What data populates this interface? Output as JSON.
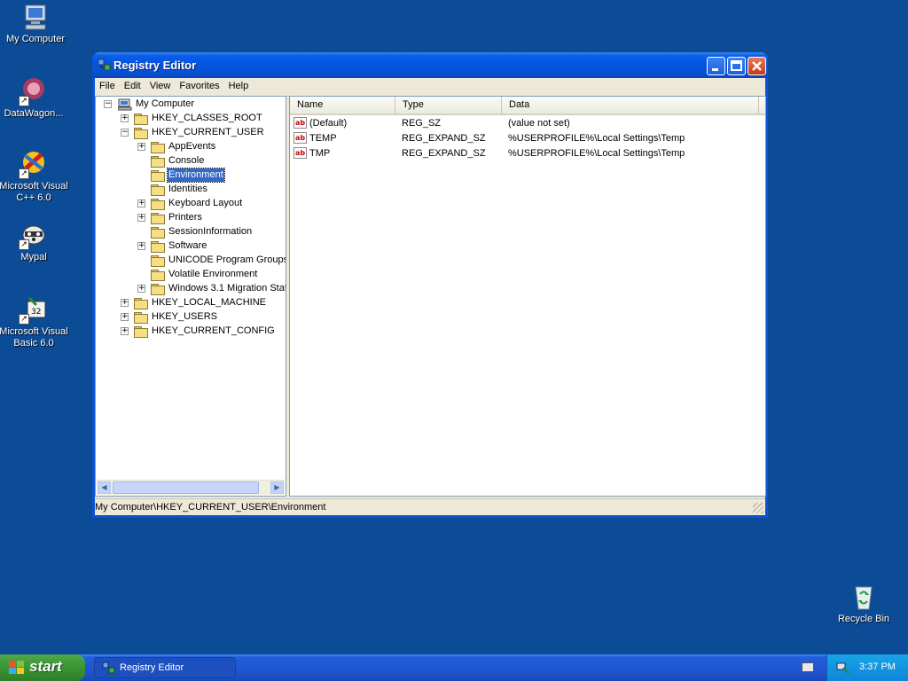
{
  "desktop": {
    "icons": [
      {
        "label": "My Computer"
      },
      {
        "label": "DataWagon..."
      },
      {
        "label": "Microsoft Visual\nC++ 6.0"
      },
      {
        "label": "Mypal"
      },
      {
        "label": "Microsoft Visual\nBasic 6.0"
      },
      {
        "label": "Recycle Bin"
      }
    ]
  },
  "window": {
    "title": "Registry Editor",
    "menu": [
      "File",
      "Edit",
      "View",
      "Favorites",
      "Help"
    ],
    "tree": {
      "root": "My Computer",
      "hives": [
        {
          "label": "HKEY_CLASSES_ROOT",
          "expander": "+"
        },
        {
          "label": "HKEY_CURRENT_USER",
          "expander": "−"
        },
        {
          "label": "HKEY_LOCAL_MACHINE",
          "expander": "+"
        },
        {
          "label": "HKEY_USERS",
          "expander": "+"
        },
        {
          "label": "HKEY_CURRENT_CONFIG",
          "expander": "+"
        }
      ],
      "hkcu_children": [
        {
          "label": "AppEvents",
          "expander": "+"
        },
        {
          "label": "Console",
          "expander": ""
        },
        {
          "label": "Environment",
          "expander": "",
          "selected": true
        },
        {
          "label": "Identities",
          "expander": ""
        },
        {
          "label": "Keyboard Layout",
          "expander": "+"
        },
        {
          "label": "Printers",
          "expander": "+"
        },
        {
          "label": "SessionInformation",
          "expander": ""
        },
        {
          "label": "Software",
          "expander": "+"
        },
        {
          "label": "UNICODE Program Groups",
          "expander": ""
        },
        {
          "label": "Volatile Environment",
          "expander": ""
        },
        {
          "label": "Windows 3.1 Migration Stat",
          "expander": "+"
        }
      ]
    },
    "list": {
      "columns": [
        "Name",
        "Type",
        "Data"
      ],
      "rows": [
        {
          "icon": "ab",
          "name": "(Default)",
          "type": "REG_SZ",
          "data": "(value not set)"
        },
        {
          "icon": "ab",
          "name": "TEMP",
          "type": "REG_EXPAND_SZ",
          "data": "%USERPROFILE%\\Local Settings\\Temp"
        },
        {
          "icon": "ab",
          "name": "TMP",
          "type": "REG_EXPAND_SZ",
          "data": "%USERPROFILE%\\Local Settings\\Temp"
        }
      ]
    },
    "status": "My Computer\\HKEY_CURRENT_USER\\Environment"
  },
  "taskbar": {
    "start_label": "start",
    "tasks": [
      {
        "label": "Registry Editor"
      }
    ],
    "clock": "3:37 PM"
  },
  "colors": {
    "desktop": "#0c4b96",
    "titlebar": "#0554e2",
    "selection": "#316ac5",
    "start_button": "#3c9a36"
  }
}
